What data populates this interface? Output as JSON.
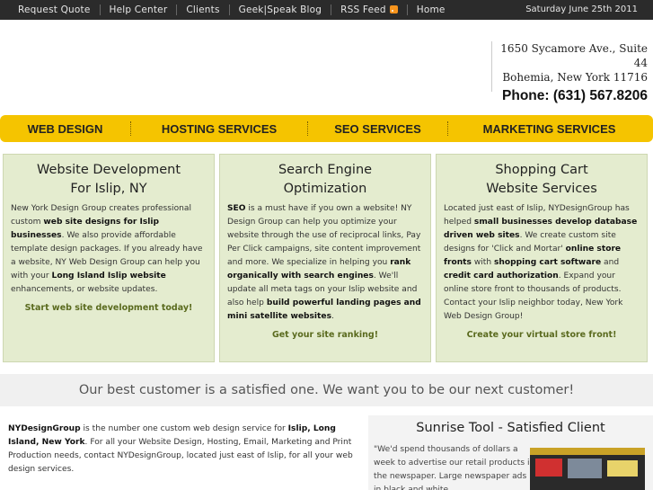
{
  "topnav": {
    "items": [
      "Request Quote",
      "Help Center",
      "Clients",
      "Geek|Speak Blog",
      "RSS Feed",
      "Home"
    ],
    "date": "Saturday June 25th 2011"
  },
  "address": {
    "line1": "1650 Sycamore Ave., Suite 44",
    "line2": "Bohemia, New York 11716",
    "phone": "Phone: (631) 567.8206"
  },
  "mainnav": {
    "items": [
      "WEB DESIGN",
      "HOSTING SERVICES",
      "SEO SERVICES",
      "MARKETING SERVICES"
    ]
  },
  "columns": [
    {
      "title1": "Website Development",
      "title2": "For Islip, NY",
      "p": [
        "New York Design Group creates professional custom ",
        "web site designs for Islip businesses",
        ". We also provide affordable template design packages. If you already have a website, NY Web Design Group can help you with your ",
        "Long Island Islip website",
        " enhancements, or website updates."
      ],
      "cta": "Start web site development today!"
    },
    {
      "title1": "Search Engine",
      "title2": "Optimization",
      "p": [
        "SEO",
        " is a must have if you own a website! NY Design Group can help you optimize your website through the use of reciprocal links, Pay Per Click campaigns, site content improvement and more. We specialize in helping you ",
        "rank organically with search engines",
        ". We'll update all meta tags on your Islip website and also help ",
        "build powerful landing pages and mini satellite websites",
        "."
      ],
      "cta": "Get your site ranking!"
    },
    {
      "title1": "Shopping Cart",
      "title2": "Website Services",
      "p": [
        "Located just east of Islip, NYDesignGroup has helped ",
        "small businesses develop database driven web sites",
        ". We create custom site designs for 'Click and Mortar' ",
        "online store fronts",
        " with ",
        "shopping cart software",
        " and ",
        "credit card authorization",
        ". Expand your online store front to thousands of products. Contact your Islip neighbor today, New York Web Design Group!"
      ],
      "cta": "Create your virtual store front!"
    }
  ],
  "banner": "Our best customer is a satisfied one. We want you to be our next customer!",
  "bottom_left": {
    "b1": "NYDesignGroup",
    "t1": " is the number one custom web design service for ",
    "b2": "Islip, Long Island, New York",
    "t2": ". For all your Website Design, Hosting, Email, Marketing and Print Production needs, contact NYDesignGroup, located just east of Islip, for all your web design services."
  },
  "bottom_right": {
    "title": "Sunrise Tool - Satisfied Client",
    "quote": "\"We'd spend thousands of dollars a week to advertise our retail products in the newspaper. Large newspaper ads in black and white"
  },
  "colors": {
    "topbar": "#2b2b2b",
    "nav_yellow": "#f5c400",
    "column_bg": "#e4eccf",
    "cta_green": "#5a6a1e",
    "rss_orange": "#f7941d"
  }
}
